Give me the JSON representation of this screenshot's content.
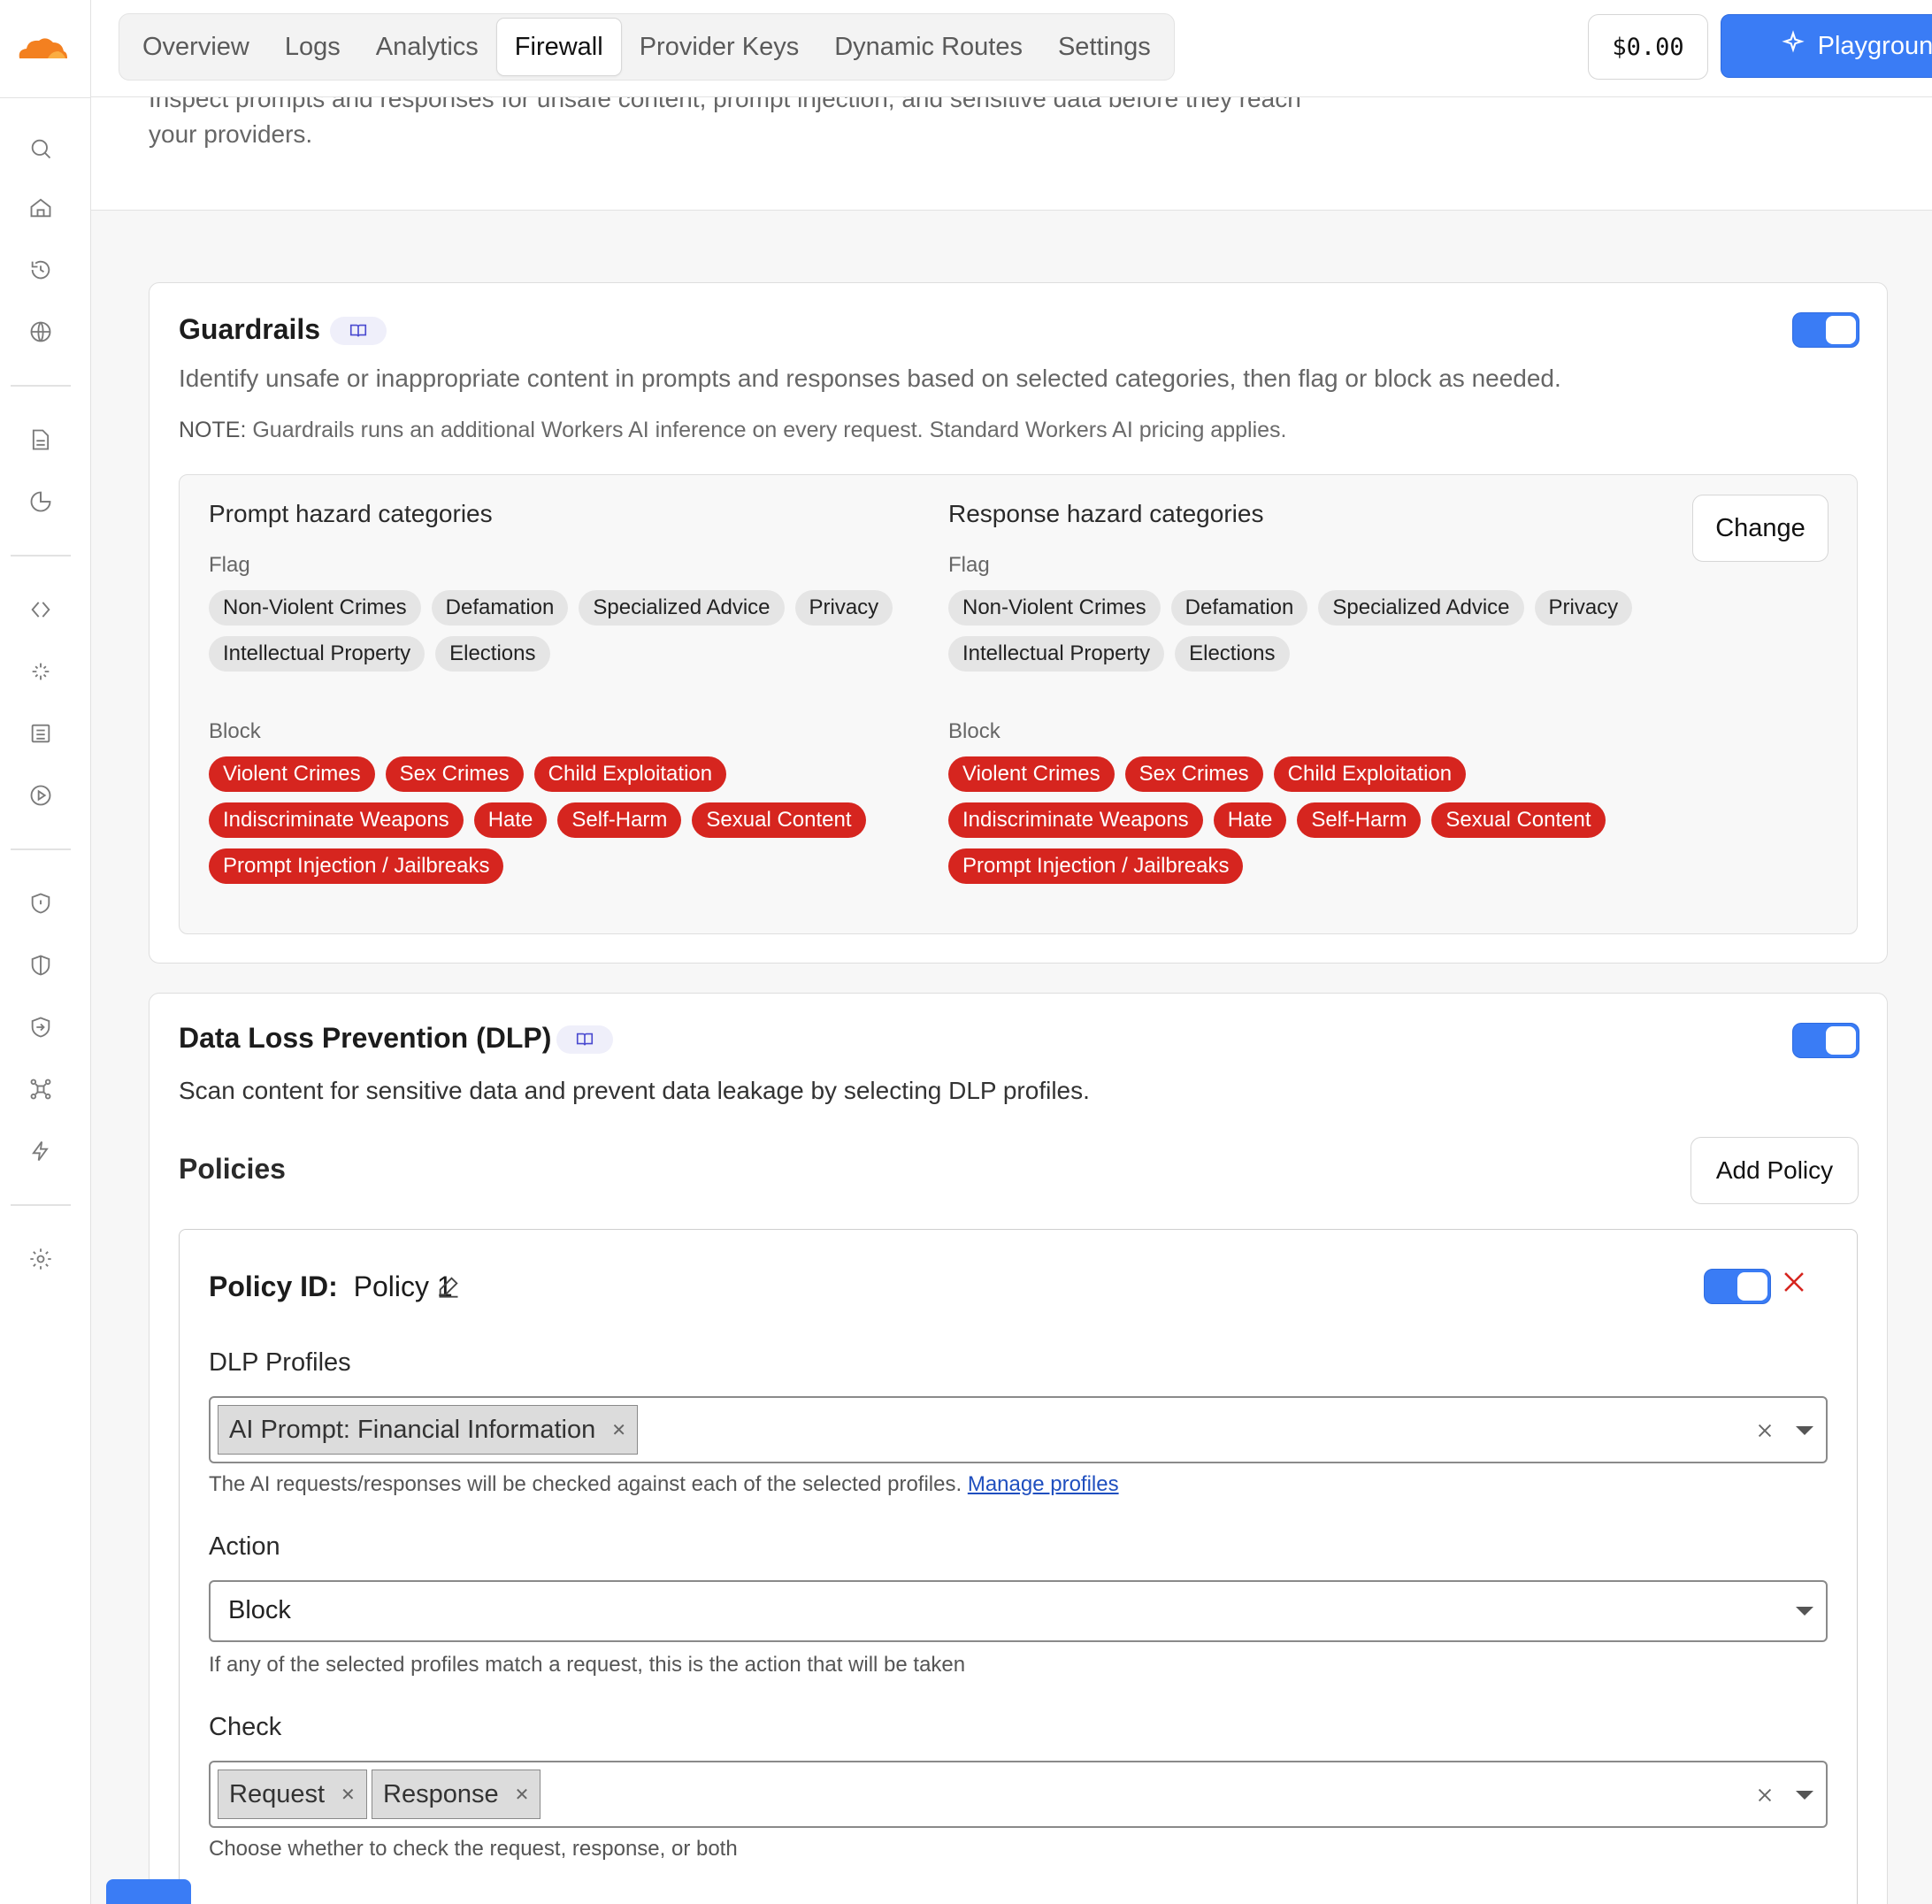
{
  "nav": {
    "tabs": [
      {
        "label": "Overview"
      },
      {
        "label": "Logs"
      },
      {
        "label": "Analytics"
      },
      {
        "label": "Firewall"
      },
      {
        "label": "Provider Keys"
      },
      {
        "label": "Dynamic Routes"
      },
      {
        "label": "Settings"
      }
    ],
    "active_tab": "Firewall",
    "cost": "$0.00",
    "playground_label": "Playground"
  },
  "header": {
    "description": "Inspect prompts and responses for unsafe content, prompt injection, and sensitive data before they reach your providers."
  },
  "rail": {
    "icons": [
      "search-icon",
      "home-icon",
      "history-icon",
      "globe-icon",
      "document-icon",
      "pie-chart-icon",
      "code-icon",
      "sparkle-icon",
      "list-icon",
      "play-icon",
      "shield-icon",
      "shield-half-icon",
      "login-icon",
      "network-icon",
      "bolt-icon",
      "gear-icon"
    ]
  },
  "guardrails": {
    "title": "Guardrails",
    "enabled": true,
    "description": "Identify unsafe or inappropriate content in prompts and responses based on selected categories, then flag or block as needed.",
    "note_label": "NOTE:",
    "note_text": "Guardrails runs an additional Workers AI inference on every request. Standard Workers AI pricing applies.",
    "change_label": "Change",
    "prompt": {
      "title": "Prompt hazard categories",
      "flag_label": "Flag",
      "flag": [
        "Non-Violent Crimes",
        "Defamation",
        "Specialized Advice",
        "Privacy",
        "Intellectual Property",
        "Elections"
      ],
      "block_label": "Block",
      "block": [
        "Violent Crimes",
        "Sex Crimes",
        "Child Exploitation",
        "Indiscriminate Weapons",
        "Hate",
        "Self-Harm",
        "Sexual Content",
        "Prompt Injection / Jailbreaks"
      ]
    },
    "response": {
      "title": "Response hazard categories",
      "flag_label": "Flag",
      "flag": [
        "Non-Violent Crimes",
        "Defamation",
        "Specialized Advice",
        "Privacy",
        "Intellectual Property",
        "Elections"
      ],
      "block_label": "Block",
      "block": [
        "Violent Crimes",
        "Sex Crimes",
        "Child Exploitation",
        "Indiscriminate Weapons",
        "Hate",
        "Self-Harm",
        "Sexual Content",
        "Prompt Injection / Jailbreaks"
      ]
    }
  },
  "dlp": {
    "title": "Data Loss Prevention (DLP)",
    "enabled": true,
    "description": "Scan content for sensitive data and prevent data leakage by selecting DLP profiles.",
    "policies_label": "Policies",
    "add_policy_label": "Add Policy",
    "policy": {
      "id_label": "Policy ID:",
      "id_value": "Policy 1",
      "enabled": true,
      "profiles_label": "DLP Profiles",
      "profiles": [
        "AI Prompt: Financial Information"
      ],
      "profiles_helper": "The AI requests/responses will be checked against each of the selected profiles.",
      "manage_profiles_link": "Manage profiles",
      "action_label": "Action",
      "action_value": "Block",
      "action_helper": "If any of the selected profiles match a request, this is the action that will be taken",
      "check_label": "Check",
      "check": [
        "Request",
        "Response"
      ],
      "check_helper": "Choose whether to check the request, response, or both"
    }
  },
  "colors": {
    "accent": "#3a7cf5",
    "block_chip": "#d6251f",
    "flag_chip": "#e5e5e5",
    "brand_orange": "#f38020"
  }
}
